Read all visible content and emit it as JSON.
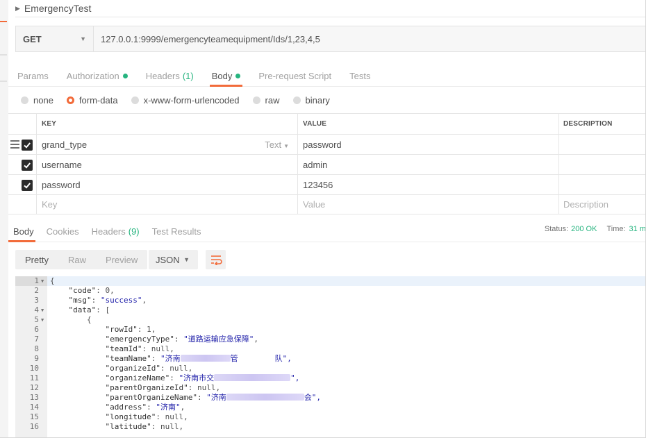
{
  "request": {
    "name": "EmergencyTest",
    "method": "GET",
    "url": "127.0.0.1:9999/emergencyteamequipment/Ids/1,23,4,5"
  },
  "request_tabs": [
    {
      "label": "Params",
      "dot": false,
      "count": ""
    },
    {
      "label": "Authorization",
      "dot": true,
      "count": ""
    },
    {
      "label": "Headers",
      "dot": false,
      "count": "(1)"
    },
    {
      "label": "Body",
      "dot": true,
      "count": ""
    },
    {
      "label": "Pre-request Script",
      "dot": false,
      "count": ""
    },
    {
      "label": "Tests",
      "dot": false,
      "count": ""
    }
  ],
  "body_modes": [
    {
      "label": "none",
      "selected": false
    },
    {
      "label": "form-data",
      "selected": true
    },
    {
      "label": "x-www-form-urlencoded",
      "selected": false
    },
    {
      "label": "raw",
      "selected": false
    },
    {
      "label": "binary",
      "selected": false
    }
  ],
  "form_table": {
    "headers": {
      "key": "KEY",
      "value": "VALUE",
      "description": "DESCRIPTION"
    },
    "rows": [
      {
        "key": "grand_type",
        "type": "Text",
        "value": "password",
        "checked": true
      },
      {
        "key": "username",
        "value": "admin",
        "checked": true
      },
      {
        "key": "password",
        "value": "123456",
        "checked": true
      }
    ],
    "placeholders": {
      "key": "Key",
      "value": "Value",
      "description": "Description"
    }
  },
  "response_tabs": [
    {
      "label": "Body",
      "count": ""
    },
    {
      "label": "Cookies",
      "count": ""
    },
    {
      "label": "Headers",
      "count": "(9)"
    },
    {
      "label": "Test Results",
      "count": ""
    }
  ],
  "status": {
    "label": "Status:",
    "value": "200 OK",
    "time_label": "Time:",
    "time_value": "31 m"
  },
  "view_modes": [
    "Pretty",
    "Raw",
    "Preview"
  ],
  "format": "JSON",
  "code_lines": [
    {
      "n": "1",
      "fold": true,
      "text": "{"
    },
    {
      "n": "2",
      "fold": false,
      "text": "    \"code\": 0,"
    },
    {
      "n": "3",
      "fold": false,
      "text": "    \"msg\": \"success\","
    },
    {
      "n": "4",
      "fold": true,
      "text": "    \"data\": ["
    },
    {
      "n": "5",
      "fold": true,
      "text": "        {"
    },
    {
      "n": "6",
      "fold": false,
      "text": "            \"rowId\": 1,"
    },
    {
      "n": "7",
      "fold": false,
      "text": "            \"emergencyType\": \"道路运输应急保障\","
    },
    {
      "n": "8",
      "fold": false,
      "text": "            \"teamId\": null,"
    },
    {
      "n": "9",
      "fold": false,
      "text": "            \"teamName\": \"济南",
      "blur": 72,
      "tail": "管        队\","
    },
    {
      "n": "10",
      "fold": false,
      "text": "            \"organizeId\": null,"
    },
    {
      "n": "11",
      "fold": false,
      "text": "            \"organizeName\": \"济南市交",
      "blur": 110,
      "tail": "\","
    },
    {
      "n": "12",
      "fold": false,
      "text": "            \"parentOrganizeId\": null,"
    },
    {
      "n": "13",
      "fold": false,
      "text": "            \"parentOrganizeName\": \"济南",
      "blur": 112,
      "tail": "会\","
    },
    {
      "n": "14",
      "fold": false,
      "text": "            \"address\": \"济南\","
    },
    {
      "n": "15",
      "fold": false,
      "text": "            \"longitude\": null,"
    },
    {
      "n": "16",
      "fold": false,
      "text": "            \"latitude\": null,"
    }
  ]
}
